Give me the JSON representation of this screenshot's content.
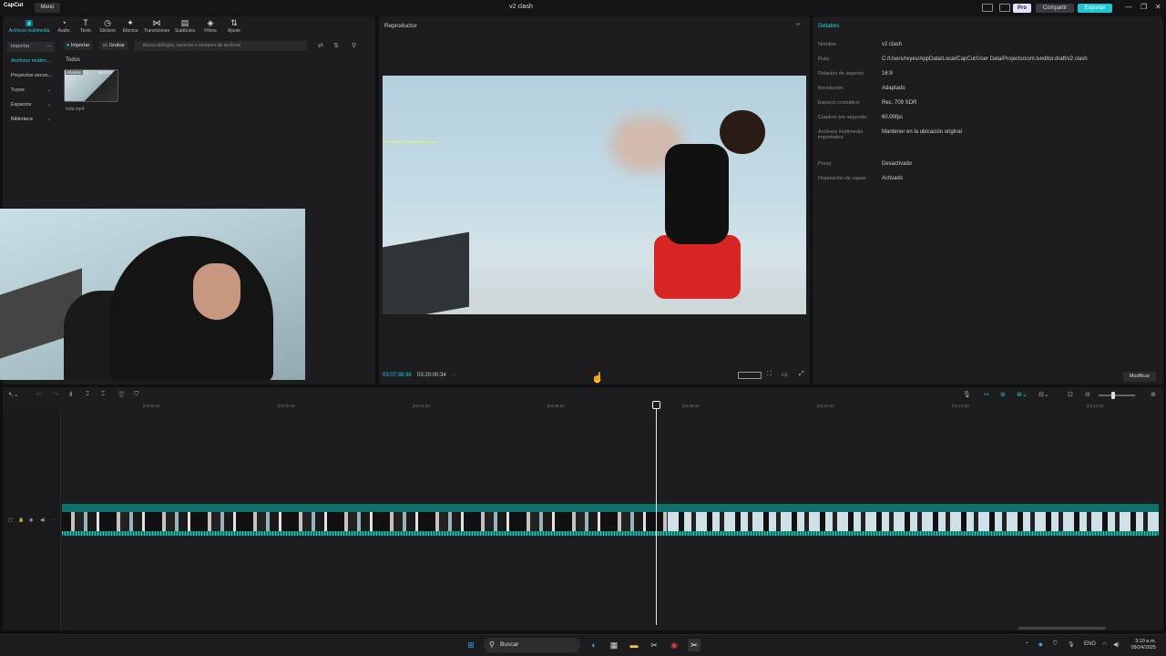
{
  "app": {
    "logo": "CapCut",
    "menu": "Menú",
    "title": "v2 clash",
    "pro": "Pro",
    "share": "Compartir",
    "export": "Exportar"
  },
  "toolbar": [
    {
      "icon": "media-icon",
      "label": "Archivos multimedia",
      "glyph": "▣"
    },
    {
      "icon": "audio-icon",
      "label": "Audio",
      "glyph": "◔"
    },
    {
      "icon": "text-icon",
      "label": "Texto",
      "glyph": "T"
    },
    {
      "icon": "stickers-icon",
      "label": "Stickers",
      "glyph": "◷"
    },
    {
      "icon": "effects-icon",
      "label": "Efectos",
      "glyph": "✦"
    },
    {
      "icon": "transitions-icon",
      "label": "Transiciones",
      "glyph": "⋈"
    },
    {
      "icon": "subtitles-icon",
      "label": "Subtítulos",
      "glyph": "▤"
    },
    {
      "icon": "filters-icon",
      "label": "Filtros",
      "glyph": "◈"
    },
    {
      "icon": "adjust-icon",
      "label": "Ajuste",
      "glyph": "⇅"
    }
  ],
  "sidebar": {
    "items": [
      {
        "label": "Importar"
      },
      {
        "label": "Archivos multim..."
      },
      {
        "label": "Proyectos secun..."
      },
      {
        "label": "Tuyos"
      },
      {
        "label": "Espacios"
      },
      {
        "label": "Biblioteca"
      }
    ]
  },
  "media": {
    "import": "Importar",
    "record": "Grabar",
    "search_placeholder": "Busca diálogos, escenas o nombres de archivos",
    "filter": "Todos",
    "clip": {
      "tag": "Añadido",
      "duration": "03:20:0",
      "name": "hola.mp4"
    }
  },
  "player": {
    "title": "Reproductor",
    "current": "03:07:38:36",
    "total": "03:20:00:34",
    "overlay": "✔ nahuel171  siempre woodsa x papas"
  },
  "details": {
    "title": "Detalles",
    "rows": [
      {
        "label": "Nombre:",
        "value": "v2 clash"
      },
      {
        "label": "Ruta:",
        "value": "C:/Users/reyes/AppData/Local/CapCut/User Data/Projects/com.lveditor.draft/v2 clash"
      },
      {
        "label": "Relación de aspecto:",
        "value": "16:9"
      },
      {
        "label": "Resolución:",
        "value": "Adaptado"
      },
      {
        "label": "Espacio cromático:",
        "value": "Rec. 709 SDR"
      },
      {
        "label": "Cuadros por segundo:",
        "value": "60.00fps"
      },
      {
        "label": "Archivos multimedia importados:",
        "value": "Mantener en la ubicación original"
      },
      {
        "label": "Proxy:",
        "value": "Desactivado"
      },
      {
        "label": "Disposición de capas:",
        "value": "Activado"
      }
    ],
    "modify": "Modificar"
  },
  "timeline": {
    "ticks": [
      "|03:00:00",
      "|03:02:00",
      "|03:04:00",
      "|03:06:00",
      "|03:08:00",
      "|03:10:00",
      "|03:12:00",
      "|03:14:00"
    ]
  },
  "taskbar": {
    "search": "Buscar",
    "lang": "ENG",
    "time": "3:10 a.m.",
    "date": "09/24/2025"
  }
}
